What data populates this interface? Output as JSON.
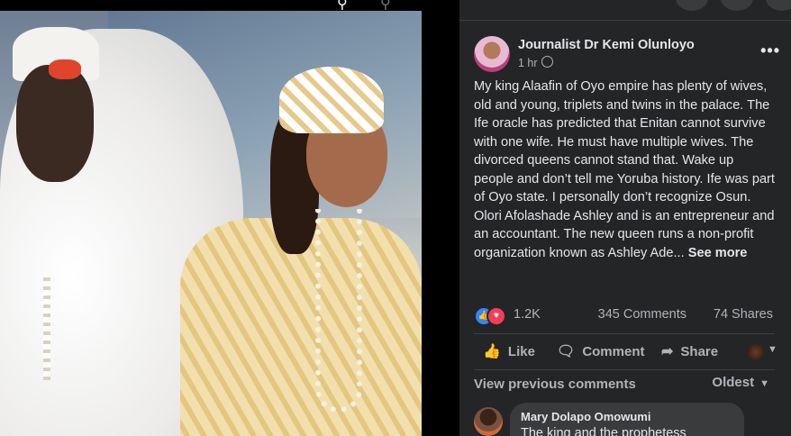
{
  "post": {
    "author": "Journalist Dr Kemi Olunloyo",
    "time": "1 hr",
    "text": "My king Alaafin of Oyo empire has plenty of wives, old and young, triplets and twins in the palace. The Ife oracle has predicted that Enitan cannot survive with one wife. He must have multiple wives. The divorced queens cannot stand that. Wake up people and don’t tell me Yoruba history. Ife was part of Oyo state. I personally don’t recognize Osun. Olori Afolashade Ashley and is an entrepreneur and an accountant. The new queen runs a non-profit organization known as Ashley Ade...",
    "see_more": "See more",
    "more_icon": "•••"
  },
  "stats": {
    "reactions": "1.2K",
    "comments": "345 Comments",
    "shares": "74 Shares"
  },
  "actions": {
    "like": "Like",
    "comment": "Comment",
    "share": "Share"
  },
  "comments_section": {
    "view_previous": "View previous comments",
    "sort": "Oldest"
  },
  "comment": {
    "name": "Mary Dolapo Omowumi",
    "text": "The king and the prophetess"
  },
  "icons": {
    "like_reaction": "like-reaction-icon",
    "love_reaction": "love-reaction-icon",
    "privacy": "globe-icon"
  },
  "colors": {
    "panel_bg": "#242526",
    "text": "#e4e6eb",
    "secondary": "#b0b3b8",
    "like_blue": "#2d88ff",
    "love_red": "#f33e58"
  }
}
